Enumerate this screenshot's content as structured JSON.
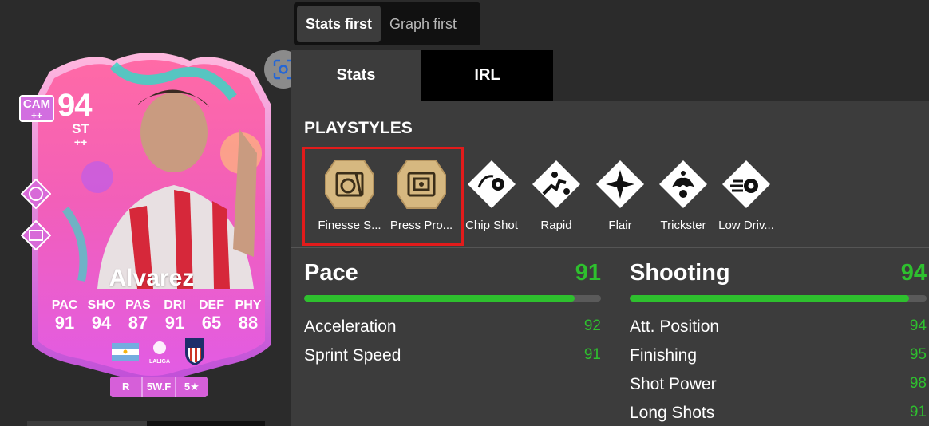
{
  "view_toggle": {
    "options": [
      "Stats first",
      "Graph first"
    ],
    "active": "Stats first"
  },
  "tabs": [
    {
      "label": "Stats",
      "active": true
    },
    {
      "label": "IRL",
      "active": false
    }
  ],
  "card": {
    "rating": "94",
    "alt_position": "CAM",
    "alt_position_plus": "++",
    "position": "ST",
    "position_plus": "++",
    "name": "Alvarez",
    "stats": [
      {
        "label": "PAC",
        "value": "91"
      },
      {
        "label": "SHO",
        "value": "94"
      },
      {
        "label": "PAS",
        "value": "87"
      },
      {
        "label": "DRI",
        "value": "91"
      },
      {
        "label": "DEF",
        "value": "65"
      },
      {
        "label": "PHY",
        "value": "88"
      }
    ],
    "badges": [
      "R",
      "5W.F",
      "5★"
    ],
    "league_label": "LALIGA"
  },
  "playstyles": {
    "title": "PLAYSTYLES",
    "items": [
      {
        "label": "Finesse S...",
        "plus": true,
        "icon": "finesse-shot-icon"
      },
      {
        "label": "Press Pro...",
        "plus": true,
        "icon": "press-proven-icon"
      },
      {
        "label": "Chip Shot",
        "plus": false,
        "icon": "chip-shot-icon"
      },
      {
        "label": "Rapid",
        "plus": false,
        "icon": "rapid-icon"
      },
      {
        "label": "Flair",
        "plus": false,
        "icon": "flair-icon"
      },
      {
        "label": "Trickster",
        "plus": false,
        "icon": "trickster-icon"
      },
      {
        "label": "Low Driv...",
        "plus": false,
        "icon": "low-driven-shot-icon"
      }
    ]
  },
  "stat_groups": [
    {
      "name": "Pace",
      "value": "91",
      "fill": 0.91,
      "stats": [
        {
          "name": "Acceleration",
          "value": "92"
        },
        {
          "name": "Sprint Speed",
          "value": "91"
        }
      ]
    },
    {
      "name": "Shooting",
      "value": "94",
      "fill": 0.94,
      "stats": [
        {
          "name": "Att. Position",
          "value": "94"
        },
        {
          "name": "Finishing",
          "value": "95"
        },
        {
          "name": "Shot Power",
          "value": "98"
        },
        {
          "name": "Long Shots",
          "value": "91"
        }
      ]
    }
  ],
  "colors": {
    "accent_green": "#2ec02e",
    "highlight_red": "#e21b1b",
    "card_pink": "#e94fb2"
  }
}
